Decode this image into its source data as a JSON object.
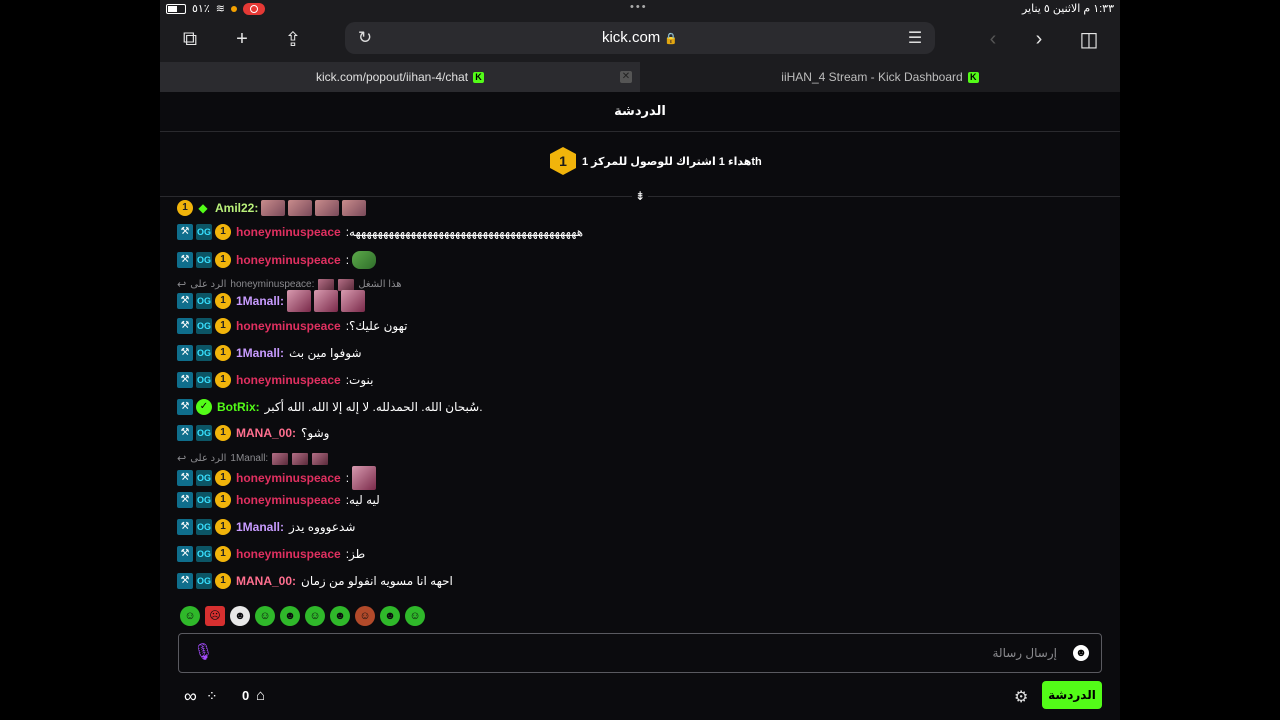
{
  "statusbar": {
    "battery_pct": "٥١٪",
    "time_date": "١:٣٣ م  الاثنين ٥ يناير",
    "dots": "•••"
  },
  "toolbar": {
    "url": "kick.com"
  },
  "tabs": [
    {
      "label": "kick.com/popout/iihan-4/chat",
      "active": true
    },
    {
      "label": "iiHAN_4 Stream - Kick Dashboard",
      "active": false
    }
  ],
  "chat": {
    "title": "الدردشة",
    "pinned": {
      "badge": "1",
      "text": "هداء 1 اشتراك للوصول للمركز 1th"
    },
    "messages": [
      {
        "user": "Amil22:",
        "text": ""
      },
      {
        "user": "honeyminuspeace",
        "text": ":هههههههههههههههههههههههههههههههههههههههههه"
      },
      {
        "user": "honeyminuspeace",
        "text": ":"
      },
      {
        "reply_label": "الرد على",
        "reply_to": "honeyminuspeace:",
        "reply_text": "هذا الشغل"
      },
      {
        "user": "1Manall:",
        "text": ""
      },
      {
        "user": "honeyminuspeace",
        "text": ":تهون عليك؟"
      },
      {
        "user": "1Manall:",
        "text": "شوفوا مين بث"
      },
      {
        "user": "honeyminuspeace",
        "text": ":بنوت"
      },
      {
        "user": "BotRix:",
        "text": "سُبحان الله. الحمدلله. لا إله إلا الله. الله أكبر."
      },
      {
        "user": "MANA_00:",
        "text": "وشو؟"
      },
      {
        "reply_label": "الرد على",
        "reply_to": "1Manall:"
      },
      {
        "user": "honeyminuspeace",
        "text": ":"
      },
      {
        "user": "honeyminuspeace",
        "text": ":ليه ليه"
      },
      {
        "user": "1Manall:",
        "text": "شدعوووه يدز"
      },
      {
        "user": "honeyminuspeace",
        "text": ":طز"
      },
      {
        "user": "MANA_00:",
        "text": "احهه انا مسويه انفولو من زمان"
      }
    ],
    "badges": {
      "sub": "1",
      "og": "OG"
    },
    "input_placeholder": "إرسال رسالة",
    "bottom": {
      "points": "0",
      "chat_button": "الدردشة"
    }
  },
  "colors": {
    "kick_green": "#53fc18",
    "sub_gold": "#f1b40b",
    "user_red": "#e03060",
    "user_purple": "#c89bff",
    "user_pink": "#ff6f8f"
  }
}
